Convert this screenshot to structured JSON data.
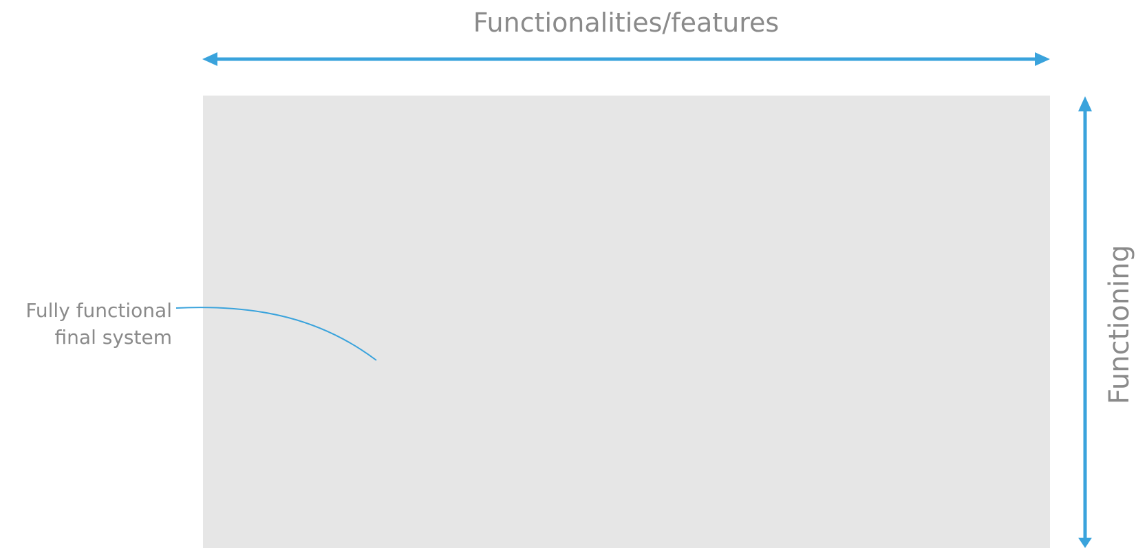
{
  "diagram": {
    "x_axis_label": "Functionalities/features",
    "y_axis_label": "Functioning",
    "callout": {
      "line1": "Fully functional",
      "line2": "final system"
    }
  },
  "colors": {
    "accent": "#3aa3dc",
    "area": "#e6e6e6",
    "text": "#8a8a8a",
    "background": "#ffffff"
  }
}
